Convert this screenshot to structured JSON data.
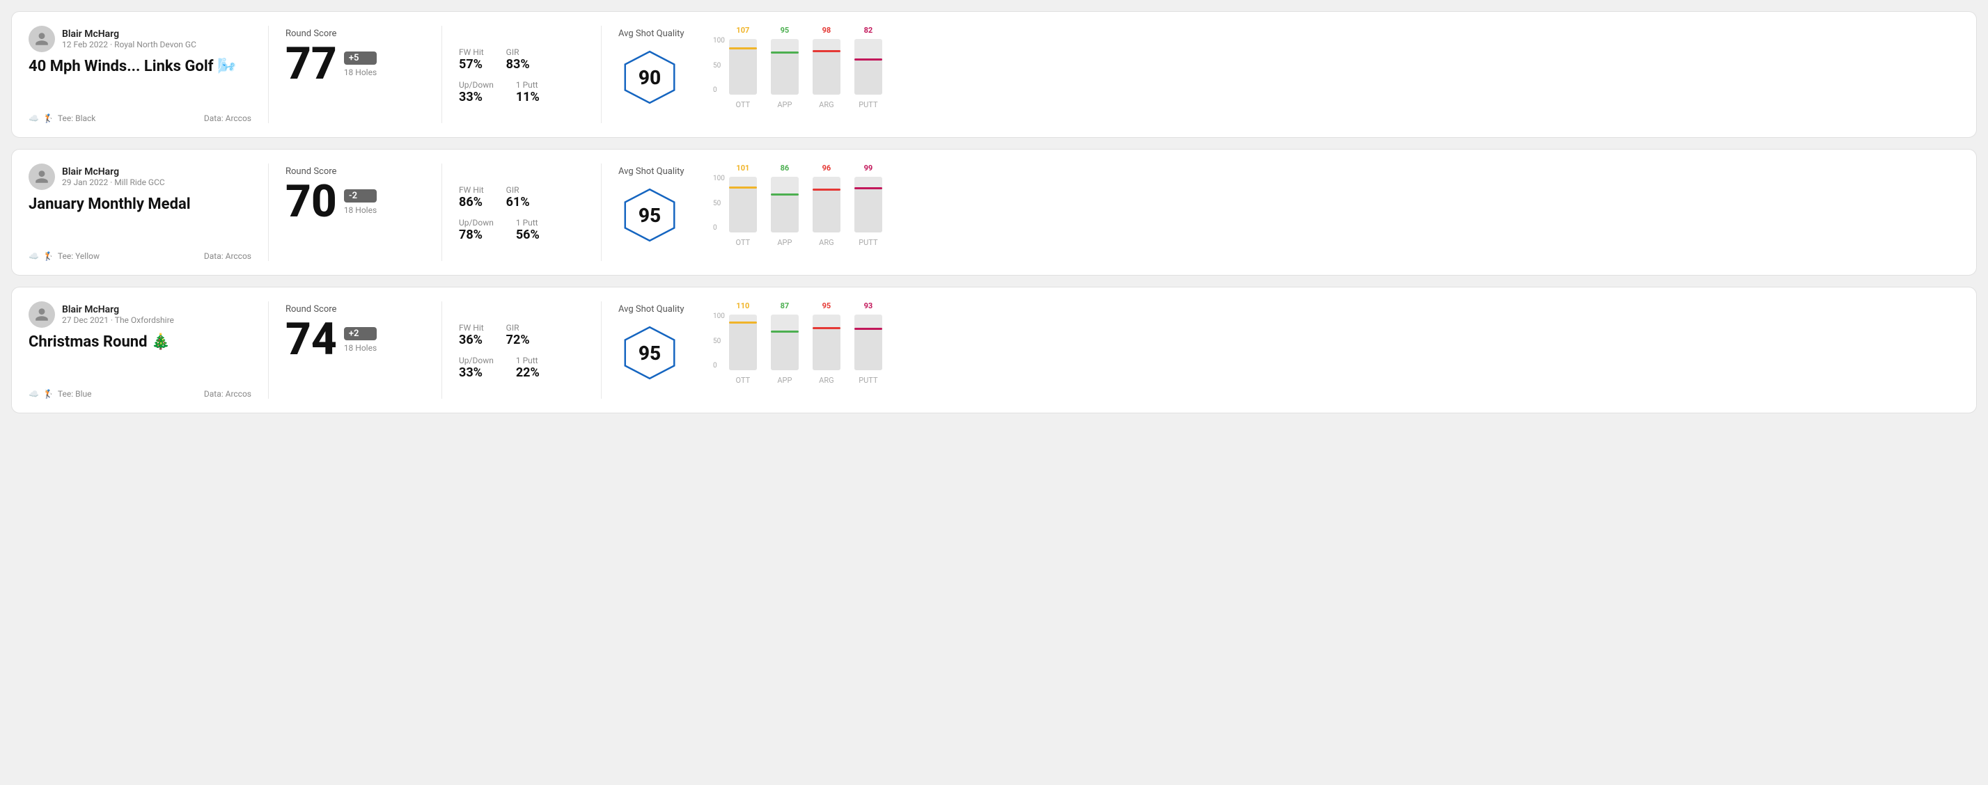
{
  "rounds": [
    {
      "id": "round-1",
      "player_name": "Blair McHarg",
      "date": "12 Feb 2022 · Royal North Devon GC",
      "title": "40 Mph Winds... Links Golf 🌬️",
      "tee": "Tee: Black",
      "data_source": "Data: Arccos",
      "score": "77",
      "score_diff": "+5",
      "score_diff_type": "over",
      "holes": "18 Holes",
      "fw_hit": "57%",
      "gir": "83%",
      "up_down": "33%",
      "one_putt": "11%",
      "avg_shot_quality": "90",
      "chart": {
        "bars": [
          {
            "label": "OTT",
            "value": 107,
            "color": "#f0b429",
            "pct": 85
          },
          {
            "label": "APP",
            "value": 95,
            "color": "#4caf50",
            "pct": 78
          },
          {
            "label": "ARG",
            "value": 98,
            "color": "#e53935",
            "pct": 80
          },
          {
            "label": "PUTT",
            "value": 82,
            "color": "#c2185b",
            "pct": 65
          }
        ]
      }
    },
    {
      "id": "round-2",
      "player_name": "Blair McHarg",
      "date": "29 Jan 2022 · Mill Ride GCC",
      "title": "January Monthly Medal",
      "tee": "Tee: Yellow",
      "data_source": "Data: Arccos",
      "score": "70",
      "score_diff": "-2",
      "score_diff_type": "under",
      "holes": "18 Holes",
      "fw_hit": "86%",
      "gir": "61%",
      "up_down": "78%",
      "one_putt": "56%",
      "avg_shot_quality": "95",
      "chart": {
        "bars": [
          {
            "label": "OTT",
            "value": 101,
            "color": "#f0b429",
            "pct": 82
          },
          {
            "label": "APP",
            "value": 86,
            "color": "#4caf50",
            "pct": 70
          },
          {
            "label": "ARG",
            "value": 96,
            "color": "#e53935",
            "pct": 79
          },
          {
            "label": "PUTT",
            "value": 99,
            "color": "#c2185b",
            "pct": 81
          }
        ]
      }
    },
    {
      "id": "round-3",
      "player_name": "Blair McHarg",
      "date": "27 Dec 2021 · The Oxfordshire",
      "title": "Christmas Round 🎄",
      "tee": "Tee: Blue",
      "data_source": "Data: Arccos",
      "score": "74",
      "score_diff": "+2",
      "score_diff_type": "over",
      "holes": "18 Holes",
      "fw_hit": "36%",
      "gir": "72%",
      "up_down": "33%",
      "one_putt": "22%",
      "avg_shot_quality": "95",
      "chart": {
        "bars": [
          {
            "label": "OTT",
            "value": 110,
            "color": "#f0b429",
            "pct": 88
          },
          {
            "label": "APP",
            "value": 87,
            "color": "#4caf50",
            "pct": 71
          },
          {
            "label": "ARG",
            "value": 95,
            "color": "#e53935",
            "pct": 78
          },
          {
            "label": "PUTT",
            "value": 93,
            "color": "#c2185b",
            "pct": 76
          }
        ]
      }
    }
  ],
  "labels": {
    "round_score": "Round Score",
    "avg_shot_quality": "Avg Shot Quality",
    "fw_hit": "FW Hit",
    "gir": "GIR",
    "up_down": "Up/Down",
    "one_putt": "1 Putt",
    "data_arccos": "Data: Arccos",
    "y_100": "100",
    "y_50": "50",
    "y_0": "0"
  }
}
